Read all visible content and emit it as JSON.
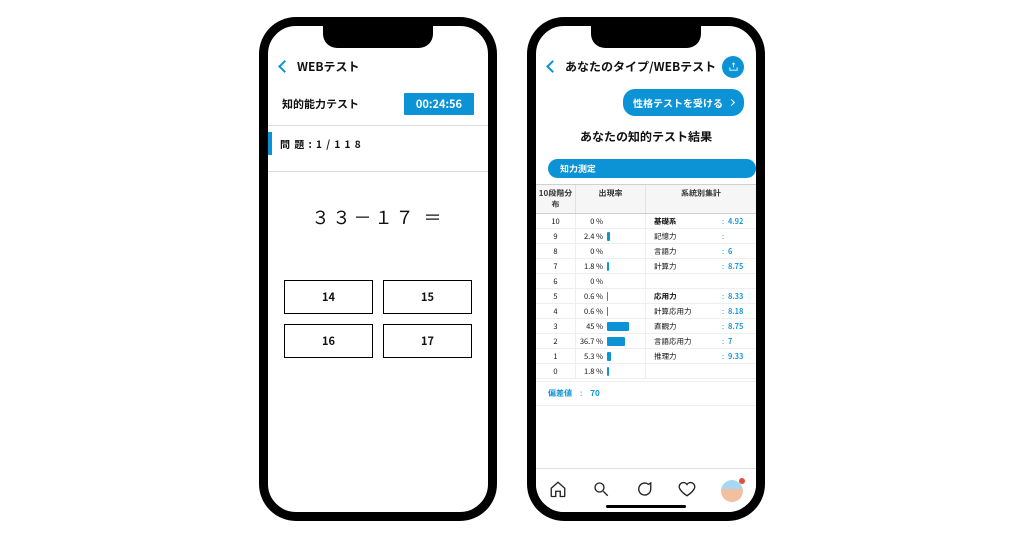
{
  "left": {
    "header_title": "WEBテスト",
    "sub_title": "知的能力テスト",
    "timer": "00:24:56",
    "qcount": "問 題 : 1  /  1 1 8",
    "question": "３３－１７ ＝",
    "answers": [
      "14",
      "15",
      "16",
      "17"
    ]
  },
  "right": {
    "header_title": "あなたのタイプ/WEBテスト",
    "cta_label": "性格テストを受ける",
    "result_title": "あなたの知的テスト結果",
    "badge": "知力測定",
    "table_headers": {
      "c1": "10段階分布",
      "c2": "出現率",
      "c3": "系統別集計"
    },
    "distribution": [
      {
        "n": "10",
        "p": "0 %",
        "w": 0
      },
      {
        "n": "9",
        "p": "2.4 %",
        "w": 3
      },
      {
        "n": "8",
        "p": "0 %",
        "w": 0
      },
      {
        "n": "7",
        "p": "1.8 %",
        "w": 2
      },
      {
        "n": "6",
        "p": "0 %",
        "w": 0
      },
      {
        "n": "5",
        "p": "0.6 %",
        "w": 1
      },
      {
        "n": "4",
        "p": "0.6 %",
        "w": 1
      },
      {
        "n": "3",
        "p": "45 %",
        "w": 22
      },
      {
        "n": "2",
        "p": "36.7 %",
        "w": 18
      },
      {
        "n": "1",
        "p": "5.3 %",
        "w": 4
      },
      {
        "n": "0",
        "p": "1.8 %",
        "w": 2
      }
    ],
    "stats": [
      {
        "label": "基礎系",
        "value": "4.92",
        "bold": true
      },
      {
        "label": "記憶力",
        "value": ""
      },
      {
        "label": "言語力",
        "value": "6"
      },
      {
        "label": "計算力",
        "value": "8.75"
      },
      {
        "label": "",
        "value": ""
      },
      {
        "label": "応用力",
        "value": "8.33",
        "bold": true
      },
      {
        "label": "計算応用力",
        "value": "8.18"
      },
      {
        "label": "直観力",
        "value": "8.75"
      },
      {
        "label": "言語応用力",
        "value": "7"
      },
      {
        "label": "推理力",
        "value": "9.33"
      },
      {
        "label": "",
        "value": ""
      }
    ],
    "deviation": {
      "label": "偏差値",
      "value": "70"
    }
  }
}
